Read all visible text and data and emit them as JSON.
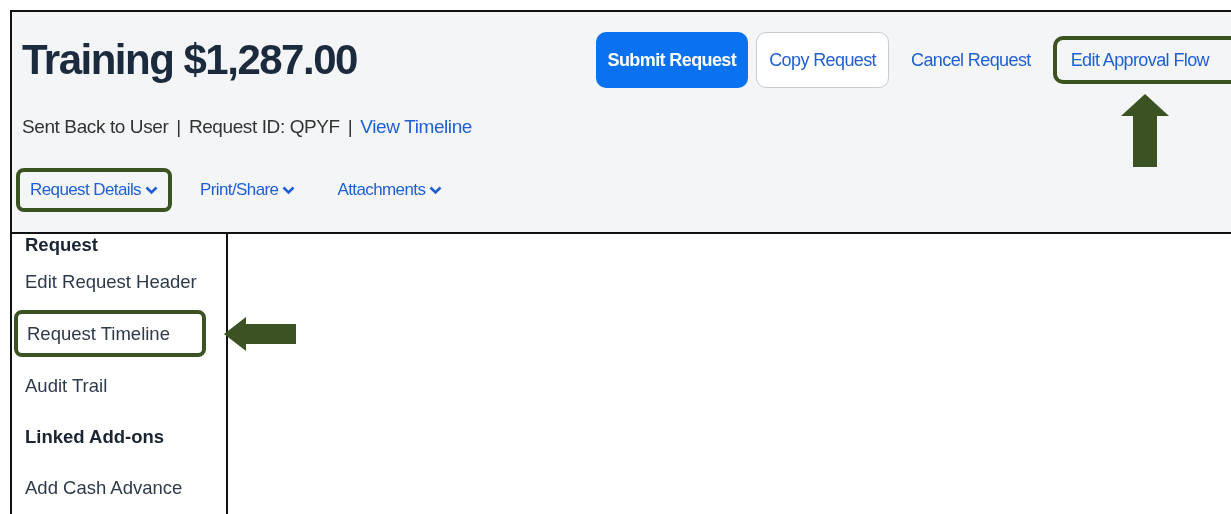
{
  "header": {
    "title": "Training $1,287.00",
    "actions": [
      {
        "label": "Submit Request",
        "kind": "primary",
        "highlighted": false
      },
      {
        "label": "Copy Request",
        "kind": "secondary",
        "highlighted": false
      },
      {
        "label": "Cancel Request",
        "kind": "link",
        "highlighted": false
      },
      {
        "label": "Edit Approval Flow",
        "kind": "link",
        "highlighted": true,
        "arrow": true
      }
    ],
    "status": "Sent Back to User",
    "separators": [
      "|",
      "|"
    ],
    "request_id": "Request ID: QPYF",
    "timeline_link": "View Timeline",
    "tabs": [
      {
        "label": "Request Details",
        "highlighted": true
      },
      {
        "label": "Print/Share",
        "highlighted": false
      },
      {
        "label": "Attachments",
        "highlighted": false
      }
    ]
  },
  "menu": {
    "items": [
      {
        "label": "Request",
        "kind": "heading",
        "highlighted": false
      },
      {
        "label": "Edit Request Header",
        "kind": "item",
        "highlighted": false
      },
      {
        "label": "Request Timeline",
        "kind": "item",
        "highlighted": true,
        "arrow": true
      },
      {
        "label": "Audit Trail",
        "kind": "item",
        "highlighted": false
      },
      {
        "label": "Linked Add-ons",
        "kind": "heading",
        "highlighted": false
      },
      {
        "label": "Add Cash Advance",
        "kind": "item",
        "highlighted": false
      }
    ]
  }
}
